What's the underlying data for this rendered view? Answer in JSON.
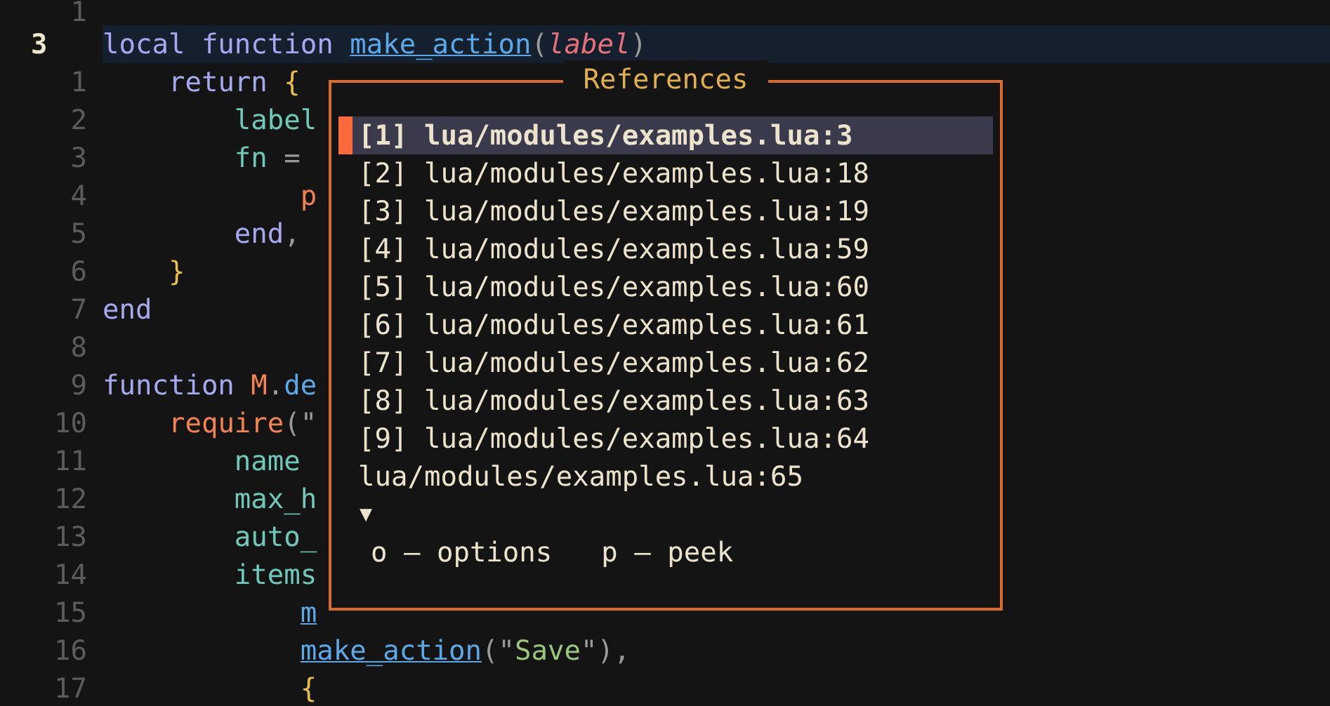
{
  "editor": {
    "lines": [
      {
        "number": "1",
        "current": false
      },
      {
        "number": "3",
        "current": true,
        "tokens": [
          {
            "text": "local function ",
            "kind": "keyword"
          },
          {
            "text": "make_action",
            "kind": "function"
          },
          {
            "text": "(",
            "kind": "punct"
          },
          {
            "text": "label",
            "kind": "param"
          },
          {
            "text": ")",
            "kind": "punct"
          }
        ]
      },
      {
        "number": "1",
        "current": false,
        "tokens": [
          {
            "text": "    return ",
            "kind": "keyword"
          },
          {
            "text": "{",
            "kind": "brace"
          }
        ]
      },
      {
        "number": "2",
        "current": false,
        "tokens": [
          {
            "text": "        label",
            "kind": "field"
          }
        ]
      },
      {
        "number": "3",
        "current": false,
        "tokens": [
          {
            "text": "        fn",
            "kind": "field"
          },
          {
            "text": " =",
            "kind": "punct"
          }
        ]
      },
      {
        "number": "4",
        "current": false,
        "tokens": [
          {
            "text": "            p",
            "kind": "builtin"
          }
        ]
      },
      {
        "number": "5",
        "current": false,
        "tokens": [
          {
            "text": "        end",
            "kind": "keyword"
          },
          {
            "text": ",",
            "kind": "punct"
          }
        ]
      },
      {
        "number": "6",
        "current": false,
        "tokens": [
          {
            "text": "    }",
            "kind": "brace"
          }
        ]
      },
      {
        "number": "7",
        "current": false,
        "tokens": [
          {
            "text": "end",
            "kind": "keyword"
          }
        ]
      },
      {
        "number": "8",
        "current": false
      },
      {
        "number": "9",
        "current": false,
        "tokens": [
          {
            "text": "function ",
            "kind": "keyword"
          },
          {
            "text": "M",
            "kind": "builtin"
          },
          {
            "text": ".",
            "kind": "punct"
          },
          {
            "text": "de",
            "kind": "method"
          }
        ]
      },
      {
        "number": "10",
        "current": false,
        "tokens": [
          {
            "text": "    require",
            "kind": "builtin"
          },
          {
            "text": "(\"",
            "kind": "punct"
          }
        ]
      },
      {
        "number": "11",
        "current": false,
        "tokens": [
          {
            "text": "        name",
            "kind": "field"
          }
        ]
      },
      {
        "number": "12",
        "current": false,
        "tokens": [
          {
            "text": "        max_h",
            "kind": "field"
          }
        ]
      },
      {
        "number": "13",
        "current": false,
        "tokens": [
          {
            "text": "        auto_",
            "kind": "field"
          }
        ]
      },
      {
        "number": "14",
        "current": false,
        "tokens": [
          {
            "text": "        items",
            "kind": "field"
          }
        ]
      },
      {
        "number": "15",
        "current": false,
        "tokens": [
          {
            "text": "            m",
            "kind": "function"
          }
        ]
      },
      {
        "number": "16",
        "current": false,
        "tokens": [
          {
            "text": "            make_action",
            "kind": "function"
          },
          {
            "text": "(\"",
            "kind": "punct"
          },
          {
            "text": "Save",
            "kind": "string"
          },
          {
            "text": "\"),",
            "kind": "punct"
          }
        ]
      },
      {
        "number": "17",
        "current": false,
        "tokens": [
          {
            "text": "            {",
            "kind": "brace"
          }
        ]
      }
    ]
  },
  "references": {
    "title": "References",
    "items": [
      {
        "label": "[1] lua/modules/examples.lua:3",
        "selected": true
      },
      {
        "label": "[2] lua/modules/examples.lua:18",
        "selected": false
      },
      {
        "label": "[3] lua/modules/examples.lua:19",
        "selected": false
      },
      {
        "label": "[4] lua/modules/examples.lua:59",
        "selected": false
      },
      {
        "label": "[5] lua/modules/examples.lua:60",
        "selected": false
      },
      {
        "label": "[6] lua/modules/examples.lua:61",
        "selected": false
      },
      {
        "label": "[7] lua/modules/examples.lua:62",
        "selected": false
      },
      {
        "label": "[8] lua/modules/examples.lua:63",
        "selected": false
      },
      {
        "label": "[9] lua/modules/examples.lua:64",
        "selected": false
      },
      {
        "label": "lua/modules/examples.lua:65",
        "selected": false
      }
    ],
    "more_indicator": "▼",
    "hints": [
      "o — options",
      "p — peek"
    ]
  }
}
